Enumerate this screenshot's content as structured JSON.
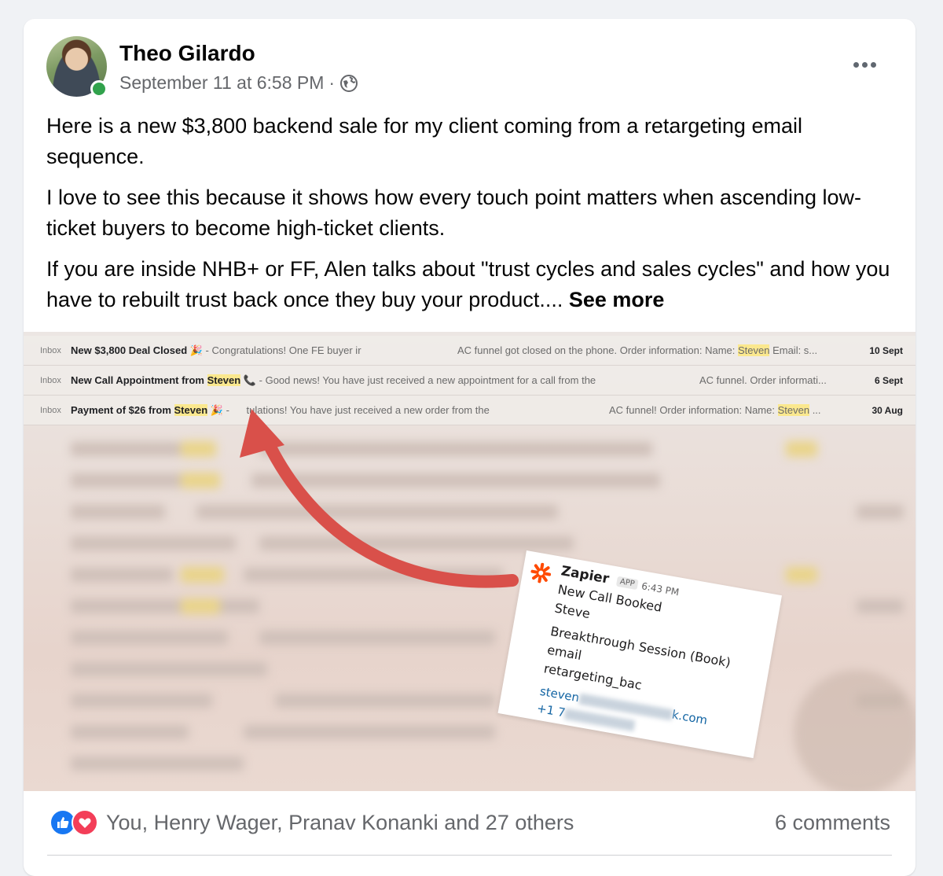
{
  "post": {
    "author": "Theo Gilardo",
    "timestamp": "September 11 at 6:58 PM",
    "separator": "·",
    "privacy_icon": "globe-icon",
    "more_icon": "more-options-icon",
    "paragraphs": [
      "Here is a new $3,800 backend sale for my client coming from a retargeting email sequence.",
      "I love to see this because it shows how every touch point matters when ascending low-ticket buyers to become high-ticket clients.",
      "If you are inside NHB+ or FF, Alen talks about \"trust cycles and sales cycles\" and how you have to rebuilt trust back once they buy your product.... "
    ],
    "see_more": "See more"
  },
  "emails": [
    {
      "tag": "Inbox",
      "subject": "New $3,800 Deal Closed 🎉",
      "snippet": " - Congratulations! One FE buyer ir",
      "right_text": "AC funnel got closed on the phone. Order information: Name: ",
      "right_highlight": "Steven",
      "right_tail": " Email: s...",
      "date": "10 Sept"
    },
    {
      "tag": "Inbox",
      "subject_pre": "New Call Appointment from ",
      "subject_highlight": "Steven",
      "subject_post": " 📞",
      "snippet": " - Good news! You have just received a new appointment for a call from the",
      "right_text": "AC funnel. Order informati...",
      "date": "6 Sept"
    },
    {
      "tag": "Inbox",
      "subject_pre": "Payment of $26 from ",
      "subject_highlight": "Steven",
      "subject_post": " 🎉",
      "snippet": " - ",
      "snippet2": "tulations! You have just received a new order from the",
      "right_text": "AC funnel! Order information: Name: ",
      "right_highlight": "Steven",
      "right_tail": " ...",
      "date": "30 Aug"
    }
  ],
  "zapier": {
    "name": "Zapier",
    "badge": "APP",
    "time": "6:43 PM",
    "lines": [
      "New Call Booked",
      "Steve",
      "Breakthrough Session (Book)",
      "email",
      "retargeting_bac"
    ],
    "email_start": "steven",
    "email_end": "k.com",
    "phone_start": "+1 7"
  },
  "colors": {
    "arrow": "#d9504a",
    "accent": "#1877f2",
    "love": "#f33e58",
    "online": "#31a24c",
    "highlight": "#fbe88e"
  },
  "footer": {
    "like_icon": "like-icon",
    "love_icon": "love-icon",
    "reactions_text": "You, Henry Wager, Pranav Konanki and 27 others",
    "comments": "6 comments"
  }
}
